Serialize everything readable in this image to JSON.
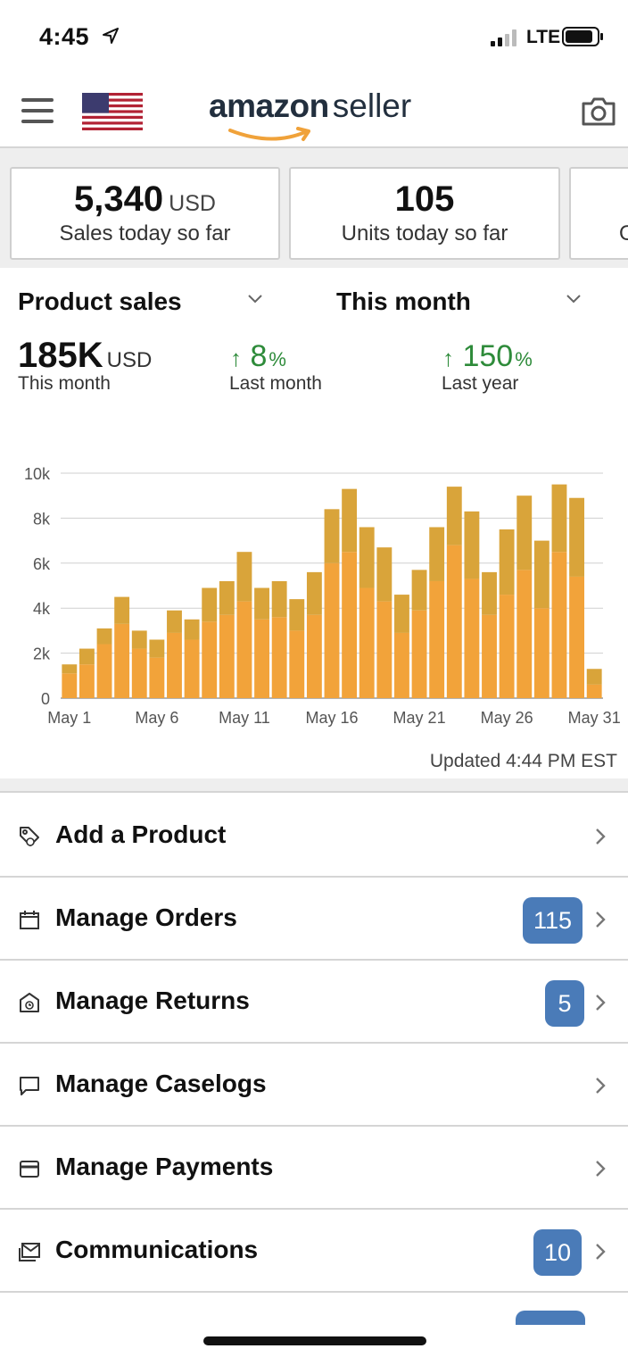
{
  "status_bar": {
    "time": "4:45",
    "network": "LTE"
  },
  "header": {
    "brand_bold": "amazon",
    "brand_light": "seller"
  },
  "stats": [
    {
      "value": "5,340",
      "unit": "USD",
      "label": "Sales today so far"
    },
    {
      "value": "105",
      "unit": "",
      "label": "Units today so far"
    },
    {
      "value": "",
      "unit": "",
      "label": "O"
    }
  ],
  "sales": {
    "metric_dropdown": "Product sales",
    "period_dropdown": "This month",
    "total_value": "185K",
    "total_unit": "USD",
    "total_label": "This month",
    "last_month_value": "8",
    "last_month_label": "Last month",
    "last_year_value": "150",
    "last_year_label": "Last year",
    "percent_sign": "%",
    "up_arrow": "↑",
    "updated": "Updated 4:44 PM EST"
  },
  "chart_data": {
    "type": "bar",
    "stacked": true,
    "categories": [
      "May 1",
      "May 2",
      "May 3",
      "May 4",
      "May 5",
      "May 6",
      "May 7",
      "May 8",
      "May 9",
      "May 10",
      "May 11",
      "May 12",
      "May 13",
      "May 14",
      "May 15",
      "May 16",
      "May 17",
      "May 18",
      "May 19",
      "May 20",
      "May 21",
      "May 22",
      "May 23",
      "May 24",
      "May 25",
      "May 26",
      "May 27",
      "May 28",
      "May 29",
      "May 30",
      "May 31"
    ],
    "x_tick_labels": [
      "May 1",
      "May 6",
      "May 11",
      "May 16",
      "May 21",
      "May 26",
      "May 31"
    ],
    "series": [
      {
        "color": "#f2a33a",
        "values": [
          1100,
          1500,
          2400,
          3300,
          2200,
          1800,
          2900,
          2600,
          3400,
          3700,
          4300,
          3500,
          3600,
          3000,
          3700,
          6000,
          6500,
          4900,
          4300,
          2900,
          3900,
          5200,
          6800,
          5300,
          3700,
          4600,
          5700,
          4000,
          6500,
          5400,
          600
        ]
      },
      {
        "color": "#d9a43a",
        "values": [
          400,
          700,
          700,
          1200,
          800,
          800,
          1000,
          900,
          1500,
          1500,
          2200,
          1400,
          1600,
          1400,
          1900,
          2400,
          2800,
          2700,
          2400,
          1700,
          1800,
          2400,
          2600,
          3000,
          1900,
          2900,
          3300,
          3000,
          3000,
          3500,
          700
        ]
      }
    ],
    "y_ticks": [
      "0",
      "2k",
      "4k",
      "6k",
      "8k",
      "10k"
    ],
    "ylim": [
      0,
      10000
    ],
    "grid": true
  },
  "menu": [
    {
      "label": "Add a Product",
      "badge": "",
      "icon": "tag-icon"
    },
    {
      "label": "Manage Orders",
      "badge": "115",
      "icon": "calendar-icon"
    },
    {
      "label": "Manage Returns",
      "badge": "5",
      "icon": "return-box-icon"
    },
    {
      "label": "Manage Caselogs",
      "badge": "",
      "icon": "chat-bubble-icon"
    },
    {
      "label": "Manage Payments",
      "badge": "",
      "icon": "card-icon"
    },
    {
      "label": "Communications",
      "badge": "10",
      "icon": "mail-icon"
    }
  ],
  "colors": {
    "accent_green": "#2e8b3a",
    "badge_blue": "#4a7bb8",
    "bar_main": "#f2a33a",
    "bar_top": "#d9a43a"
  }
}
